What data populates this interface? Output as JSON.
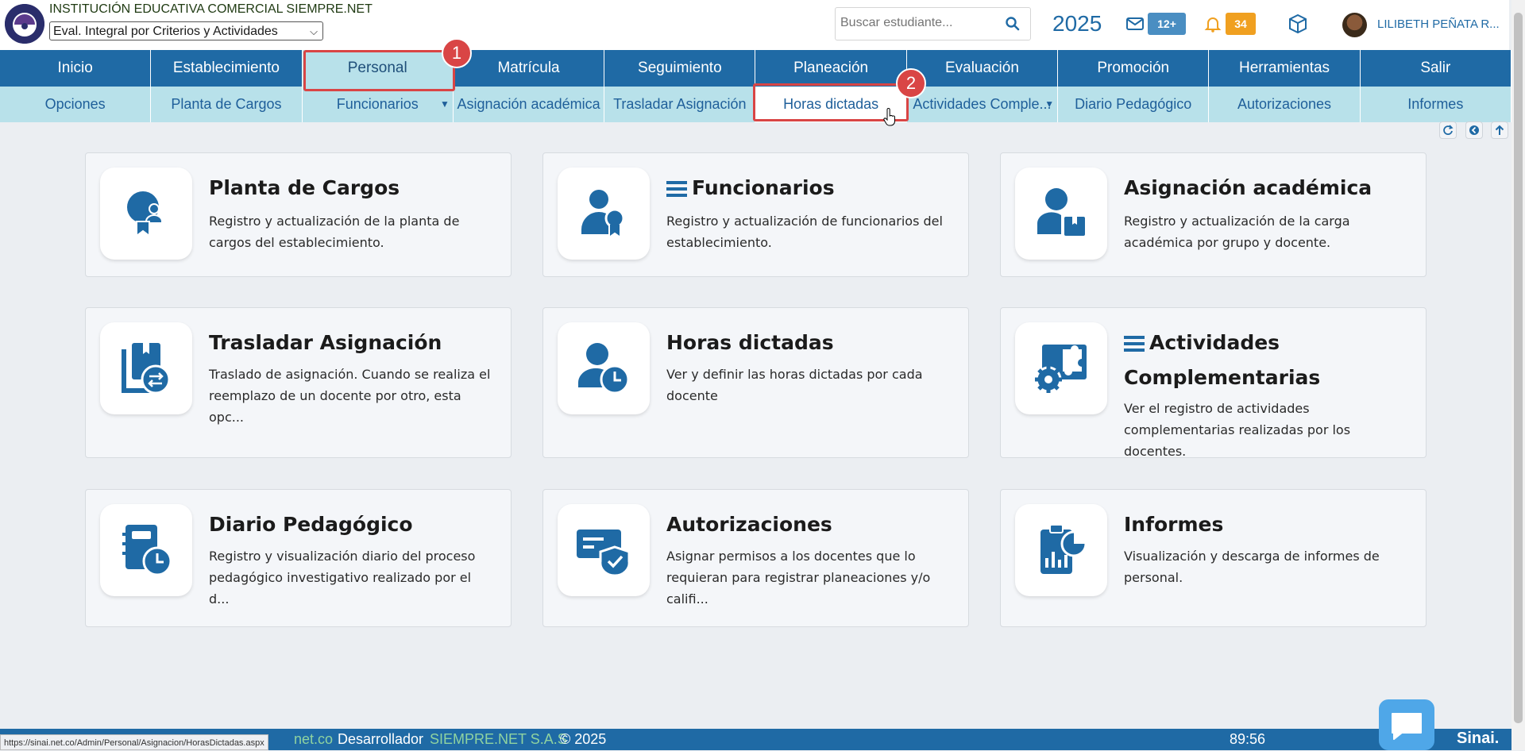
{
  "header": {
    "institution": "INSTITUCIÓN EDUCATIVA COMERCIAL SIEMPRE.NET",
    "eval_select": "Eval. Integral por Criterios y Actividades",
    "search_placeholder": "Buscar estudiante...",
    "year": "2025",
    "messages_badge": "12+",
    "notifications_badge": "34",
    "user_name": "LILIBETH PEÑATA R..."
  },
  "menu_main": [
    "Inicio",
    "Establecimiento",
    "Personal",
    "Matrícula",
    "Seguimiento",
    "Planeación",
    "Evaluación",
    "Promoción",
    "Herramientas",
    "Salir"
  ],
  "menu_sub": [
    "Opciones",
    "Planta de Cargos",
    "Funcionarios",
    "Asignación académica",
    "Trasladar Asignación",
    "Horas dictadas",
    "Actividades Comple...",
    "Diario Pedagógico",
    "Autorizaciones",
    "Informes"
  ],
  "annotations": [
    "1",
    "2"
  ],
  "cards": [
    {
      "title": "Planta de Cargos",
      "desc": "Registro y actualización de la planta de cargos del establecimiento.",
      "icon": "badge-person-icon"
    },
    {
      "title": "Funcionarios",
      "desc": "Registro y actualización de funcionarios del establecimiento.",
      "icon": "staff-award-icon"
    },
    {
      "title": "Asignación académica",
      "desc": "Registro y actualización de la carga académica por grupo y docente.",
      "icon": "teacher-book-icon"
    },
    {
      "title": "Trasladar Asignación",
      "desc": "Traslado de asignación. Cuando se realiza el reemplazo de un docente por otro, esta opc...",
      "icon": "transfer-books-icon"
    },
    {
      "title": "Horas dictadas",
      "desc": "Ver y definir las horas dictadas por cada docente",
      "icon": "person-clock-icon"
    },
    {
      "title": "Actividades Complementarias",
      "desc": "Ver el registro de actividades complementarias realizadas por los docentes.",
      "icon": "puzzle-gear-icon"
    },
    {
      "title": "Diario Pedagógico",
      "desc": "Registro y visualización diario del proceso pedagógico investigativo realizado por el d...",
      "icon": "notebook-clock-icon"
    },
    {
      "title": "Autorizaciones",
      "desc": "Asignar permisos a los docentes que lo requieran para registrar planeaciones y/o califi...",
      "icon": "shield-check-card-icon"
    },
    {
      "title": "Informes",
      "desc": "Visualización y descarga de informes de personal.",
      "icon": "report-chart-icon"
    }
  ],
  "footer": {
    "status_url": "https://sinai.net.co/Admin/Personal/Asignacion/HorasDictadas.aspx",
    "domain_tail": "net.co",
    "developer_label": "Desarrollador",
    "developer_name": "SIEMPRE.NET S.A.S",
    "copyright": "© 2025",
    "timer": "89:56",
    "brand": "Sinai."
  },
  "colors": {
    "primary": "#1f6aa5",
    "submenu": "#b8e1ea",
    "annotation": "#d94545",
    "badge_blue": "#4a8ec2",
    "badge_orange": "#f0a020"
  }
}
